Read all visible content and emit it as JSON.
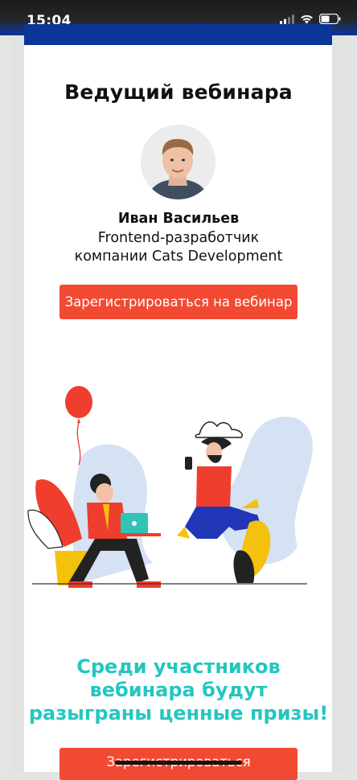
{
  "status_bar": {
    "time": "15:04"
  },
  "host": {
    "section_title": "Ведущий вебинара",
    "name": "Иван Васильев",
    "role_line1": "Frontend-разработчик",
    "role_line2": "компании Cats Development"
  },
  "cta": {
    "register_webinar": "Зарегистрироваться на вебинар",
    "register": "Зарегистрироваться"
  },
  "prize": {
    "line1": "Среди участников",
    "line2": "вебинара будут",
    "line3": "разыграны ценные призы!"
  },
  "colors": {
    "accent_button": "#f24a32",
    "prize_text": "#24c6c0",
    "brand_bar": "#0b3596"
  },
  "icons": [
    "signal-icon",
    "wifi-icon",
    "battery-icon"
  ]
}
